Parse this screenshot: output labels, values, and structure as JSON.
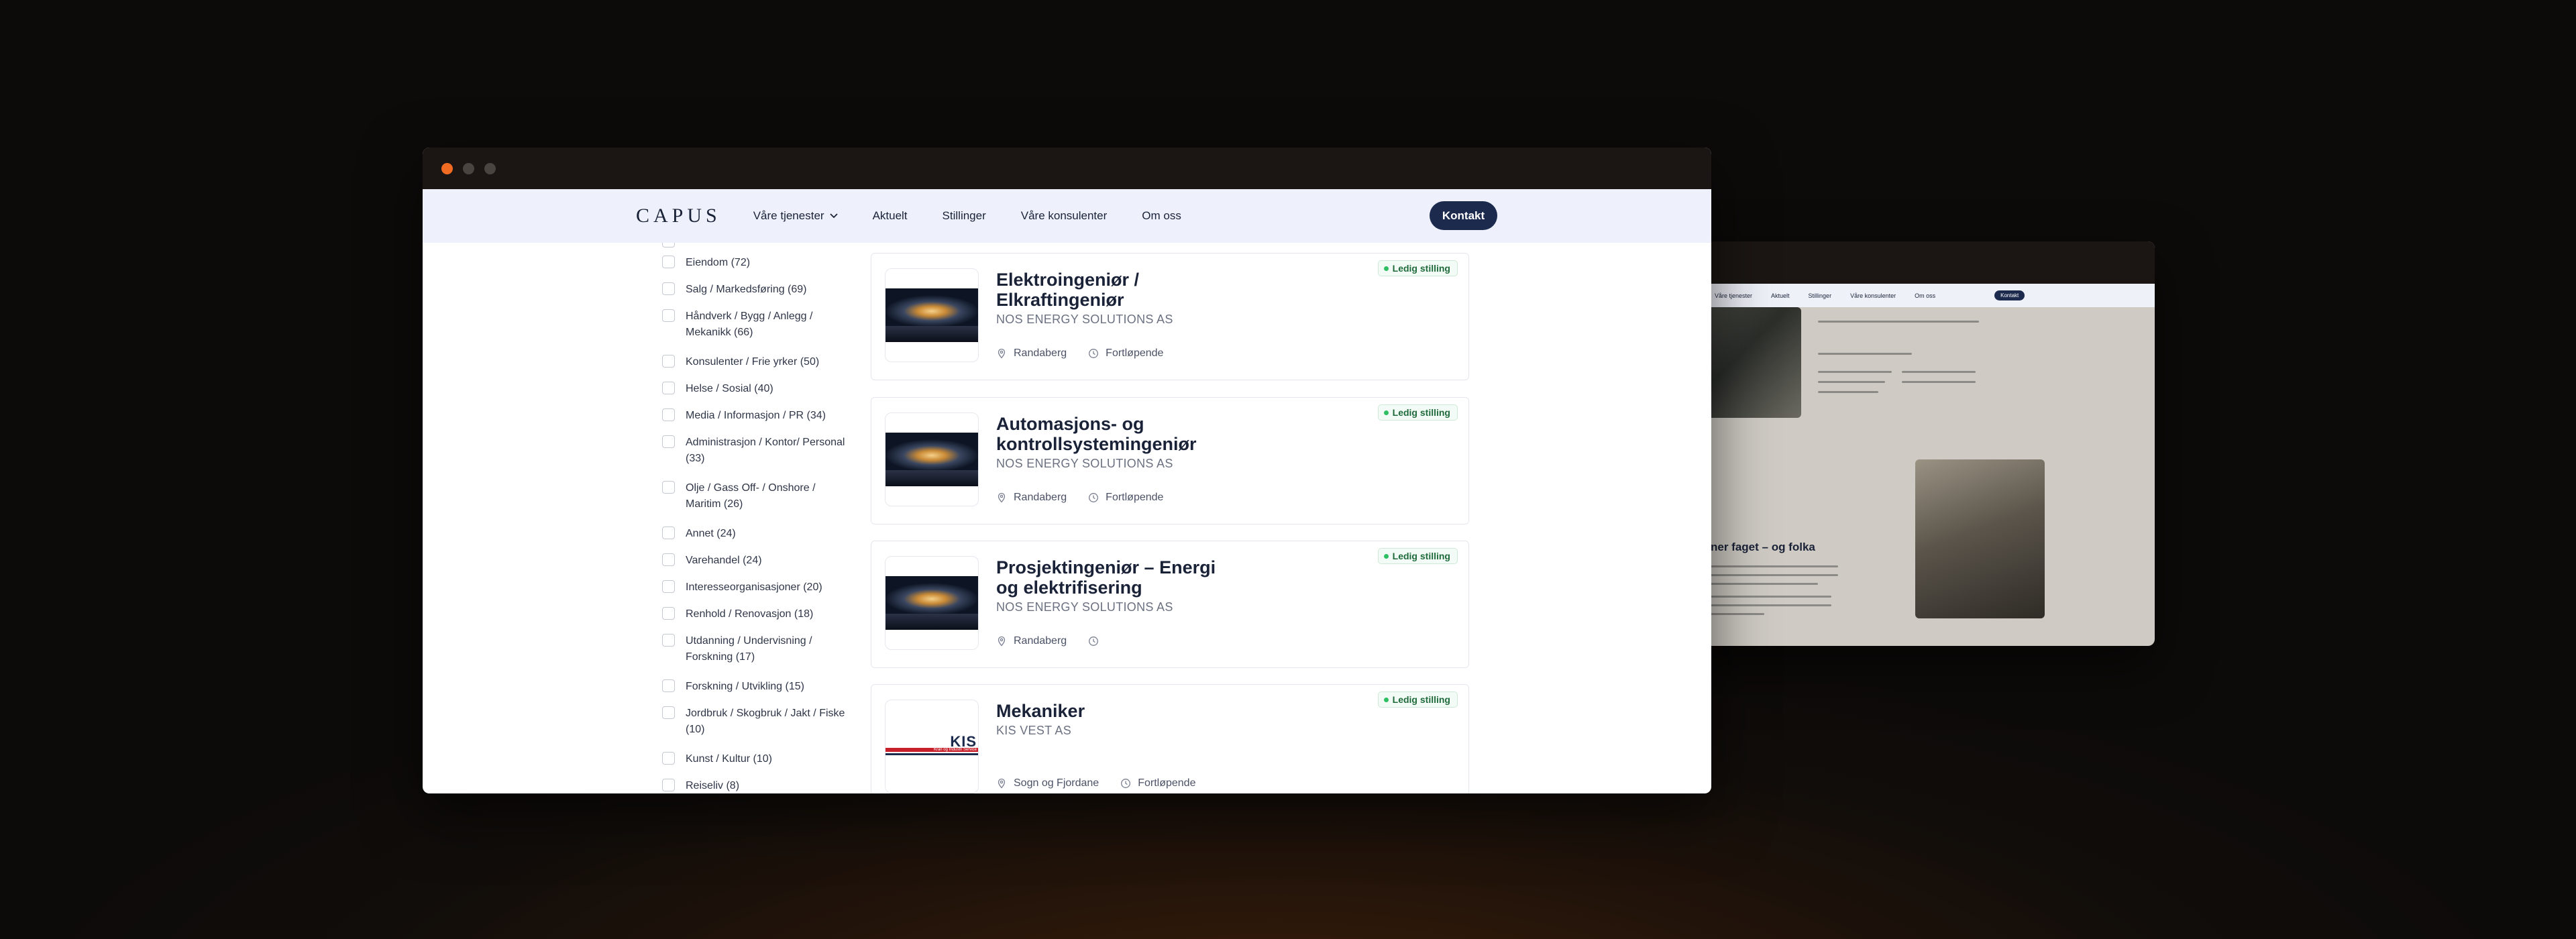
{
  "browser": {
    "dot_colors": [
      "#f26b22",
      "#4a4440",
      "#4a4440"
    ]
  },
  "header": {
    "logo": "CAPUS",
    "nav": [
      {
        "label": "Våre tjenester",
        "dropdown": true
      },
      {
        "label": "Aktuelt"
      },
      {
        "label": "Stillinger"
      },
      {
        "label": "Våre konsulenter"
      },
      {
        "label": "Om oss"
      }
    ],
    "contact_button": "Kontakt"
  },
  "filters": [
    {
      "label": "Eiendom (72)"
    },
    {
      "label": "Salg / Markedsføring (69)"
    },
    {
      "label": "Håndverk / Bygg / Anlegg / Mekanikk (66)"
    },
    {
      "label": "Konsulenter / Frie yrker (50)"
    },
    {
      "label": "Helse / Sosial (40)"
    },
    {
      "label": "Media / Informasjon / PR (34)"
    },
    {
      "label": "Administrasjon / Kontor/ Personal (33)"
    },
    {
      "label": "Olje / Gass Off- / Onshore / Maritim (26)"
    },
    {
      "label": "Annet (24)"
    },
    {
      "label": "Varehandel (24)"
    },
    {
      "label": "Interesseorganisasjoner (20)"
    },
    {
      "label": "Renhold / Renovasjon (18)"
    },
    {
      "label": "Utdanning / Undervisning / Forskning (17)"
    },
    {
      "label": "Forskning / Utvikling (15)"
    },
    {
      "label": "Jordbruk / Skogbruk / Jakt / Fiske (10)"
    },
    {
      "label": "Kunst / Kultur (10)"
    },
    {
      "label": "Reiseliv (8)"
    }
  ],
  "jobs": [
    {
      "title": "Elektroingeniør / Elkraftingeniør",
      "company": "NOS ENERGY SOLUTIONS AS",
      "location": "Randaberg",
      "deadline": "Fortløpende",
      "badge": "Ledig stilling",
      "logo_icon": "nos-energy-logo"
    },
    {
      "title": "Automasjons- og kontrollsystemingeniør",
      "company": "NOS ENERGY SOLUTIONS AS",
      "location": "Randaberg",
      "deadline": "Fortløpende",
      "badge": "Ledig stilling",
      "logo_icon": "nos-energy-logo"
    },
    {
      "title": "Prosjektingeniør – Energi og elektrifisering",
      "company": "NOS ENERGY SOLUTIONS AS",
      "location": "Randaberg",
      "deadline": "",
      "badge": "Ledig stilling",
      "logo_icon": "nos-energy-logo"
    },
    {
      "title": "Mekaniker",
      "company": "KIS VEST AS",
      "location": "Sogn og Fjordane",
      "deadline": "Fortløpende",
      "badge": "Ledig stilling",
      "logo_icon": "kis-vest-logo",
      "logo_text": "KIS",
      "logo_subtext": "Kran og Industri Service"
    }
  ],
  "background_window": {
    "nav": [
      "Våre tjenester",
      "Aktuelt",
      "Stillinger",
      "Våre konsulenter",
      "Om oss"
    ],
    "contact_button": "Kontakt",
    "heading": "ner faget – og folka"
  }
}
